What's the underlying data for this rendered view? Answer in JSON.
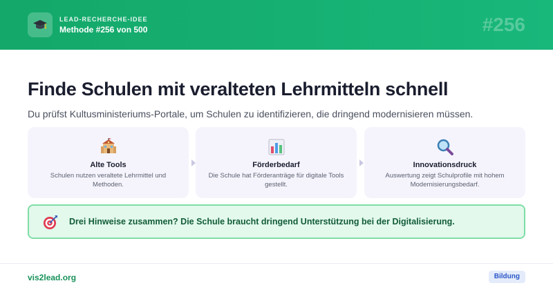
{
  "header": {
    "eyebrow": "LEAD-RECHERCHE-IDEE",
    "method_label": "Methode #256 von 500",
    "number_watermark": "#256",
    "logo_icon": "graduation-cap-icon"
  },
  "main": {
    "title": "Finde Schulen mit veralteten Lehrmitteln schnell",
    "subtitle": "Du prüfst Kultusministeriums-Portale, um Schulen zu identifizieren, die dringend modernisieren müssen."
  },
  "cards": [
    {
      "icon": "school-building-icon",
      "title": "Alte Tools",
      "description": "Schulen nutzen veraltete Lehrmittel und Methoden."
    },
    {
      "icon": "bar-chart-icon",
      "title": "Förderbedarf",
      "description": "Die Schule hat Förderanträge für digitale Tools gestellt."
    },
    {
      "icon": "magnifier-icon",
      "title": "Innovationsdruck",
      "description": "Auswertung zeigt Schulprofile mit hohem Modernisierungsbedarf."
    }
  ],
  "callout": {
    "icon": "target-icon",
    "text": "Drei Hinweise zusammen? Die Schule braucht dringend Unterstützung bei der Digitalisierung."
  },
  "footer": {
    "site": "vis2lead.org",
    "category_badge": "Bildung"
  },
  "colors": {
    "header_green": "#14a86a",
    "card_bg": "#f5f4fc",
    "callout_bg": "#e2f9ec",
    "callout_border": "#7fdda6",
    "site_text": "#18925a",
    "badge_bg": "#e4ecfb"
  }
}
